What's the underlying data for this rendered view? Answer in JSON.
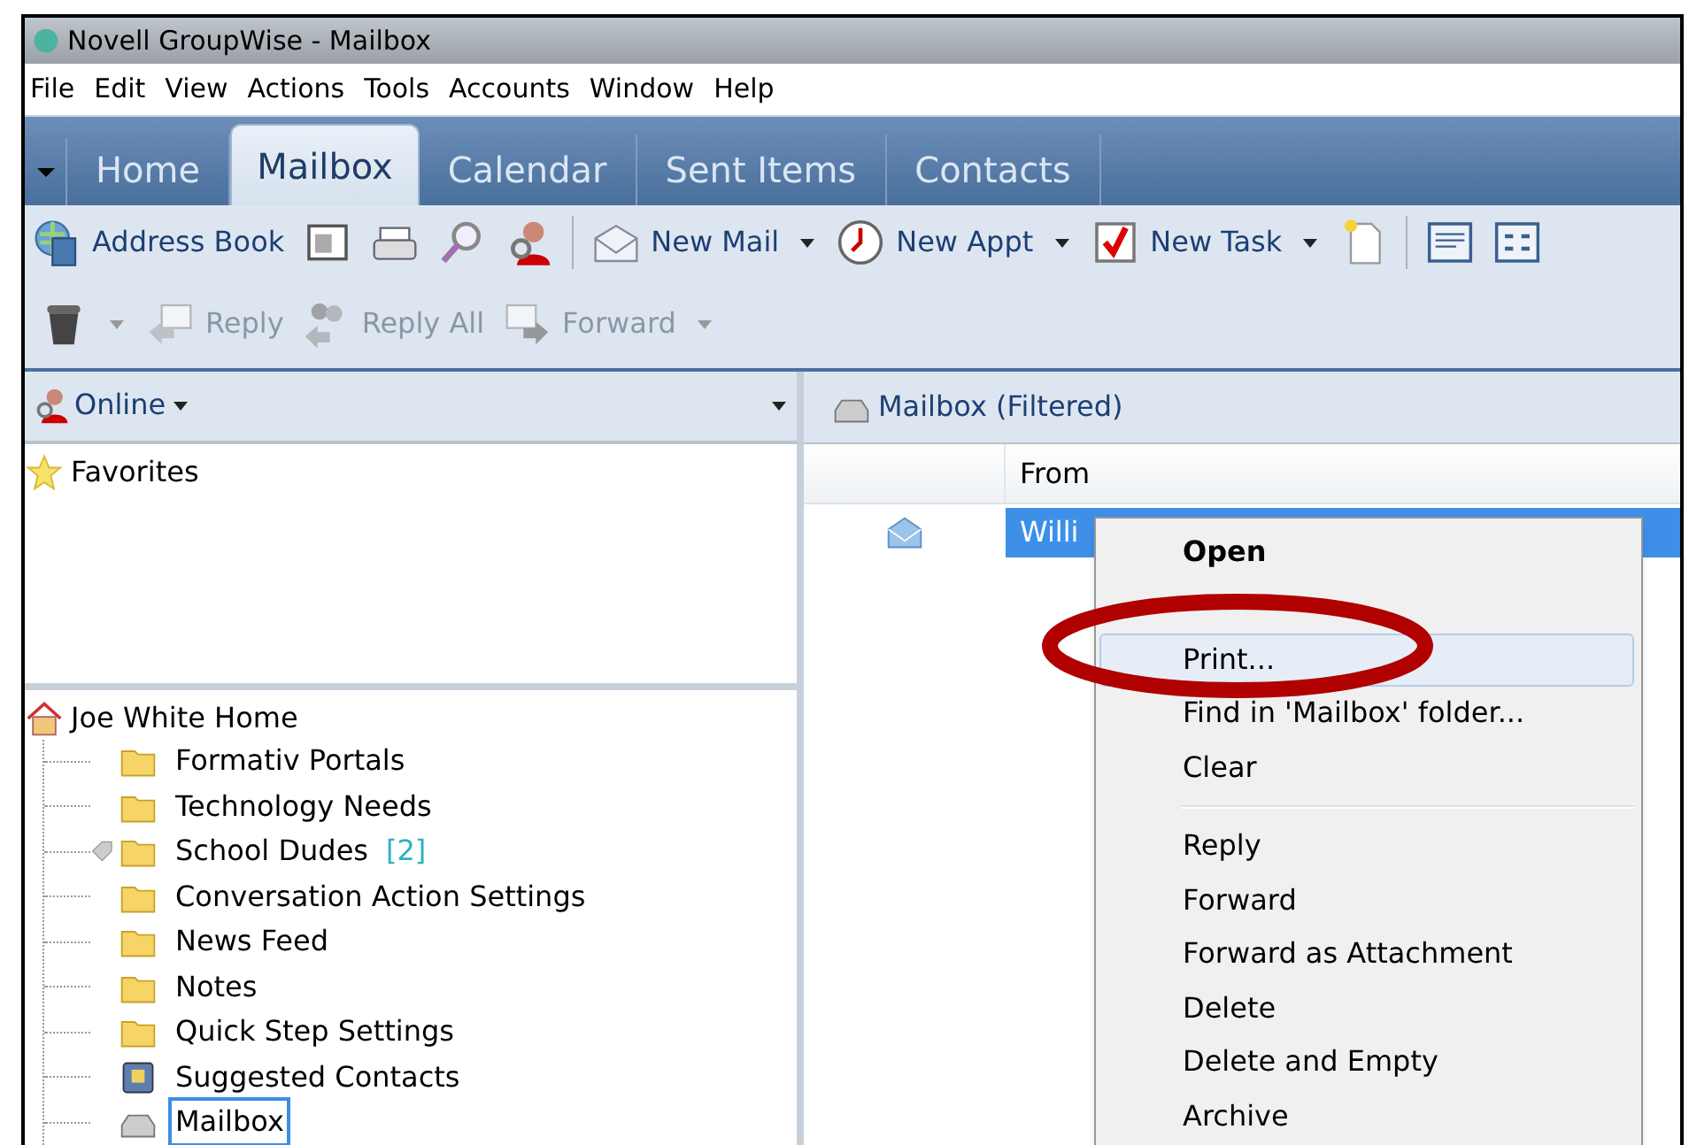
{
  "window": {
    "title": "Novell GroupWise - Mailbox"
  },
  "menu_bar": [
    "File",
    "Edit",
    "View",
    "Actions",
    "Tools",
    "Accounts",
    "Window",
    "Help"
  ],
  "tabs": [
    {
      "label": "Home",
      "selected": false
    },
    {
      "label": "Mailbox",
      "selected": true
    },
    {
      "label": "Calendar",
      "selected": false
    },
    {
      "label": "Sent Items",
      "selected": false
    },
    {
      "label": "Contacts",
      "selected": false
    }
  ],
  "toolbar_1": [
    {
      "kind": "button",
      "label": "Address Book"
    },
    {
      "kind": "icon"
    },
    {
      "kind": "icon"
    },
    {
      "kind": "icon"
    },
    {
      "kind": "icon"
    },
    {
      "kind": "separator"
    },
    {
      "kind": "button",
      "label": "New Mail"
    },
    {
      "kind": "dropdown"
    },
    {
      "kind": "button",
      "label": "New Appt"
    },
    {
      "kind": "dropdown"
    },
    {
      "kind": "button",
      "label": "New Task"
    },
    {
      "kind": "dropdown"
    },
    {
      "kind": "icon"
    },
    {
      "kind": "separator"
    },
    {
      "kind": "icon"
    },
    {
      "kind": "icon"
    }
  ],
  "toolbar_2": [
    {
      "kind": "icon"
    },
    {
      "kind": "dropdown",
      "disabled": true
    },
    {
      "kind": "button",
      "label": "Reply",
      "disabled": true
    },
    {
      "kind": "button",
      "label": "Reply All",
      "disabled": true
    },
    {
      "kind": "button",
      "label": "Forward",
      "disabled": true
    },
    {
      "kind": "dropdown",
      "disabled": true
    }
  ],
  "left_panel": {
    "mode": "Online",
    "favorites": "Favorites",
    "tree": {
      "label": "Joe White Home",
      "children": [
        {
          "label": "Formativ Portals",
          "kind": "folder",
          "selected": false
        },
        {
          "label": "Technology Needs",
          "kind": "folder",
          "selected": false
        },
        {
          "label": "School Dudes",
          "kind": "folder",
          "count": "[2]",
          "selected": false
        },
        {
          "label": "Conversation Action Settings",
          "kind": "folder",
          "selected": false
        },
        {
          "label": "News Feed",
          "kind": "folder",
          "selected": false
        },
        {
          "label": "Notes",
          "kind": "folder",
          "selected": false
        },
        {
          "label": "Quick Step Settings",
          "kind": "folder",
          "selected": false
        },
        {
          "label": "Suggested Contacts",
          "kind": "contacts",
          "selected": false
        },
        {
          "label": "Mailbox",
          "kind": "mailbox",
          "selected": true
        }
      ]
    }
  },
  "right_panel": {
    "title": "Mailbox (Filtered)",
    "columns": [
      "From"
    ],
    "rows": [
      {
        "from": "Willi",
        "selected": true
      }
    ]
  },
  "context_menu": [
    {
      "label": "Open",
      "kind": "item",
      "default": true,
      "hovered": false
    },
    {
      "label": "Print...",
      "kind": "item",
      "default": false,
      "hovered": true
    },
    {
      "label": "Find in 'Mailbox' folder...",
      "kind": "item",
      "default": false,
      "hovered": false
    },
    {
      "label": "Clear",
      "kind": "item",
      "default": false,
      "hovered": false
    },
    {
      "kind": "separator"
    },
    {
      "label": "Reply",
      "kind": "item",
      "default": false,
      "hovered": false
    },
    {
      "label": "Forward",
      "kind": "item",
      "default": false,
      "hovered": false
    },
    {
      "label": "Forward as Attachment",
      "kind": "item",
      "default": false,
      "hovered": false
    },
    {
      "label": "Delete",
      "kind": "item",
      "default": false,
      "hovered": false
    },
    {
      "label": "Delete and Empty",
      "kind": "item",
      "default": false,
      "hovered": false
    },
    {
      "label": "Archive",
      "kind": "item",
      "default": false,
      "hovered": false
    }
  ]
}
